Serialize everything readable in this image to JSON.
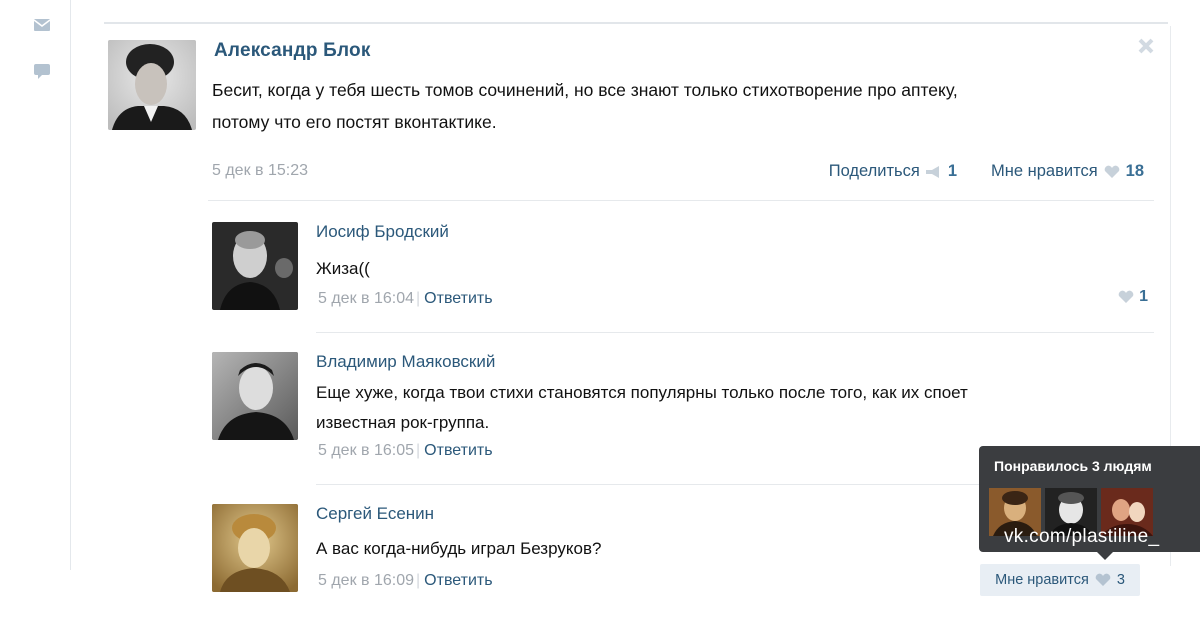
{
  "sidebar": {
    "icons": [
      "envelope-icon",
      "speech-bubble-icon"
    ]
  },
  "post": {
    "author": "Александр Блок",
    "text_line1": "Бесит, когда у тебя шесть томов сочинений, но все знают только стихотворение про аптеку,",
    "text_line2": "потому что его постят вконтактике.",
    "date": "5 дек в 15:23",
    "share_label": "Поделиться",
    "share_count": "1",
    "like_label": "Мне нравится",
    "like_count": "18"
  },
  "comments": [
    {
      "author": "Иосиф Бродский",
      "text_line1": "Жиза((",
      "date": "5 дек в 16:04",
      "reply_label": "Ответить",
      "likes": "1"
    },
    {
      "author": "Владимир Маяковский",
      "text_line1": "Еще хуже, когда твои стихи становятся популярны только после того, как их споет",
      "text_line2": "известная рок-группа.",
      "date": "5 дек в 16:05",
      "reply_label": "Ответить"
    },
    {
      "author": "Сергей Есенин",
      "text_line1": "А вас когда-нибудь играл Безруков?",
      "date": "5 дек в 16:09",
      "reply_label": "Ответить",
      "like_label": "Мне нравится",
      "likes": "3"
    }
  ],
  "tooltip": {
    "title": "Понравилось 3 людям"
  },
  "watermark": "vk.com/plastiline_",
  "colors": {
    "link": "#2b587a",
    "muted": "#a0a6ad",
    "tooltip_bg": "#3b3d40",
    "like_bg": "#e8eef4"
  }
}
